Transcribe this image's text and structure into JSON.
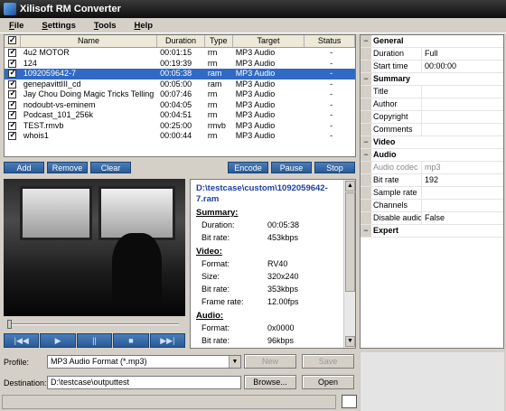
{
  "app": {
    "title": "Xilisoft RM Converter"
  },
  "menu": [
    "File",
    "Settings",
    "Tools",
    "Help"
  ],
  "filelist": {
    "headers": [
      "Name",
      "Duration",
      "Type",
      "Target",
      "Status"
    ],
    "rows": [
      {
        "name": "4u2 MOTOR",
        "duration": "00:01:15",
        "type": "rm",
        "target": "MP3 Audio",
        "status": "-"
      },
      {
        "name": "124",
        "duration": "00:19:39",
        "type": "rm",
        "target": "MP3 Audio",
        "status": "-"
      },
      {
        "name": "1092059642-7",
        "duration": "00:05:38",
        "type": "ram",
        "target": "MP3 Audio",
        "status": "-"
      },
      {
        "name": "genepavittIII_cd",
        "duration": "00:05:00",
        "type": "ram",
        "target": "MP3 Audio",
        "status": "-"
      },
      {
        "name": "Jay Chou Doing Magic Tricks Telling",
        "duration": "00:07:46",
        "type": "rm",
        "target": "MP3 Audio",
        "status": "-"
      },
      {
        "name": "nodoubt-vs-eminem",
        "duration": "00:04:05",
        "type": "rm",
        "target": "MP3 Audio",
        "status": "-"
      },
      {
        "name": "Podcast_101_256k",
        "duration": "00:04:51",
        "type": "rm",
        "target": "MP3 Audio",
        "status": "-"
      },
      {
        "name": "TEST.rmvb",
        "duration": "00:25:00",
        "type": "rmvb",
        "target": "MP3 Audio",
        "status": "-"
      },
      {
        "name": "whois1",
        "duration": "00:00:44",
        "type": "rm",
        "target": "MP3 Audio",
        "status": "-"
      }
    ]
  },
  "buttons": {
    "add": "Add",
    "remove": "Remove",
    "clear": "Clear",
    "encode": "Encode",
    "pause": "Pause",
    "stop": "Stop"
  },
  "player": {
    "prev": "|◀◀",
    "play": "▶",
    "pause": "||",
    "stop": "■",
    "next": "▶▶|"
  },
  "info": {
    "path": "D:\\testcase\\custom\\1092059642-7.ram",
    "summary_title": "Summary:",
    "summary": [
      {
        "k": "Duration:",
        "v": "00:05:38"
      },
      {
        "k": "Bit rate:",
        "v": "453kbps"
      }
    ],
    "video_title": "Video:",
    "video": [
      {
        "k": "Format:",
        "v": "RV40"
      },
      {
        "k": "Size:",
        "v": "320x240"
      },
      {
        "k": "Bit rate:",
        "v": "353kbps"
      },
      {
        "k": "Frame rate:",
        "v": "12.00fps"
      }
    ],
    "audio_title": "Audio:",
    "audio": [
      {
        "k": "Format:",
        "v": "0x0000"
      },
      {
        "k": "Bit rate:",
        "v": "96kbps"
      }
    ]
  },
  "props": [
    {
      "kind": "cat",
      "k": "General",
      "v": ""
    },
    {
      "kind": "item",
      "k": "Duration",
      "v": "Full"
    },
    {
      "kind": "item",
      "k": "Start time",
      "v": "00:00:00"
    },
    {
      "kind": "cat",
      "k": "Summary",
      "v": ""
    },
    {
      "kind": "item",
      "k": "Title",
      "v": ""
    },
    {
      "kind": "item",
      "k": "Author",
      "v": ""
    },
    {
      "kind": "item",
      "k": "Copyright",
      "v": ""
    },
    {
      "kind": "item",
      "k": "Comments",
      "v": ""
    },
    {
      "kind": "cat",
      "k": "Video",
      "v": ""
    },
    {
      "kind": "cat",
      "k": "Audio",
      "v": ""
    },
    {
      "kind": "dis",
      "k": "Audio codec",
      "v": "mp3"
    },
    {
      "kind": "item",
      "k": "Bit rate",
      "v": "192"
    },
    {
      "kind": "item",
      "k": "Sample rate",
      "v": ""
    },
    {
      "kind": "item",
      "k": "Channels",
      "v": ""
    },
    {
      "kind": "item",
      "k": "Disable audio",
      "v": "False"
    },
    {
      "kind": "cat",
      "k": "Expert",
      "v": ""
    }
  ],
  "bottom": {
    "profile_label": "Profile:",
    "profile_value": "MP3 Audio Format  (*.mp3)",
    "new_label": "New",
    "save_label": "Save",
    "destination_label": "Destination:",
    "destination_value": "D:\\testcase\\outputtest",
    "browse_label": "Browse...",
    "open_label": "Open"
  }
}
